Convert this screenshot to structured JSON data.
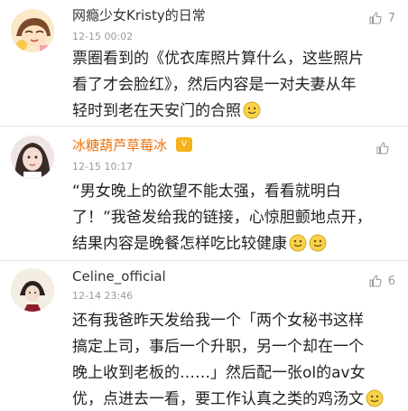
{
  "comments": [
    {
      "username": "网瘾少女Kristy的日常",
      "time": "12-15 00:02",
      "likes": "7",
      "text": "票圈看到的《优衣库照片算什么，这些照片\n看了才会脸红》，然后内容是一对夫妻从年\n轻时到老在天安门的合照",
      "emoji_count": 1,
      "avatar_icon": "cartoon-girl-avatar"
    },
    {
      "username": "冰糖葫芦草莓冰",
      "badge": "V",
      "time": "12-15 10:17",
      "likes": "",
      "text": "“男女晚上的欲望不能太强，看看就明白\n了！”我爸发给我的链接，心惊胆颤地点开，\n结果内容是晚餐怎样吃比较健康",
      "emoji_count": 2,
      "avatar_icon": "photo-girl-avatar"
    },
    {
      "username": "Celine_official",
      "time": "12-14 23:46",
      "likes": "6",
      "text": "还有我爸昨天发给我一个「两个女秘书这样\n搞定上司，事后一个升职，另一个却在一个\n晚上收到老板的……」然后配一张ol的av女\n优，点进去一看，要工作认真之类的鸡汤文",
      "emoji_count": 1,
      "avatar_icon": "illustration-avatar"
    }
  ],
  "colors": {
    "username_highlight": "#e8730c",
    "meta_gray": "#9a9a9a",
    "badge": "#f5b21b"
  }
}
